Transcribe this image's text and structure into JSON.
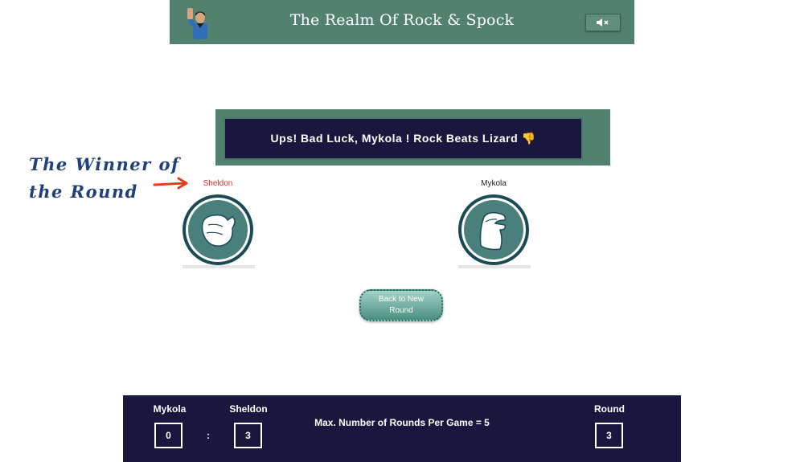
{
  "header": {
    "title": "The Realm Of Rock & Spock",
    "sound_icon": "speaker-muted-icon",
    "avatar_icon": "spock-avatar-icon"
  },
  "result": {
    "message": "Ups! Bad Luck, Mykola ! Rock Beats Lizard 👎"
  },
  "annotation": {
    "line1": "The Winner of",
    "line2": "the Round",
    "arrow_icon": "red-arrow-icon"
  },
  "players": {
    "left": {
      "name": "Sheldon",
      "name_color": "#e0301e",
      "gesture_icon": "rock-hand-icon"
    },
    "right": {
      "name": "Mykola",
      "name_color": "#222222",
      "gesture_icon": "lizard-hand-icon"
    }
  },
  "actions": {
    "back_label": "Back to New Round"
  },
  "scoreboard": {
    "player1_label": "Mykola",
    "player1_score": "0",
    "separator": ":",
    "player2_label": "Sheldon",
    "player2_score": "3",
    "max_rounds_text": "Max. Number of Rounds Per Game = 5",
    "round_label": "Round",
    "round_value": "3"
  },
  "colors": {
    "header_bg": "#52826f",
    "panel_bg": "#1a173f",
    "hand_circle": "#4a807c",
    "hand_ring": "#1a4a54"
  }
}
